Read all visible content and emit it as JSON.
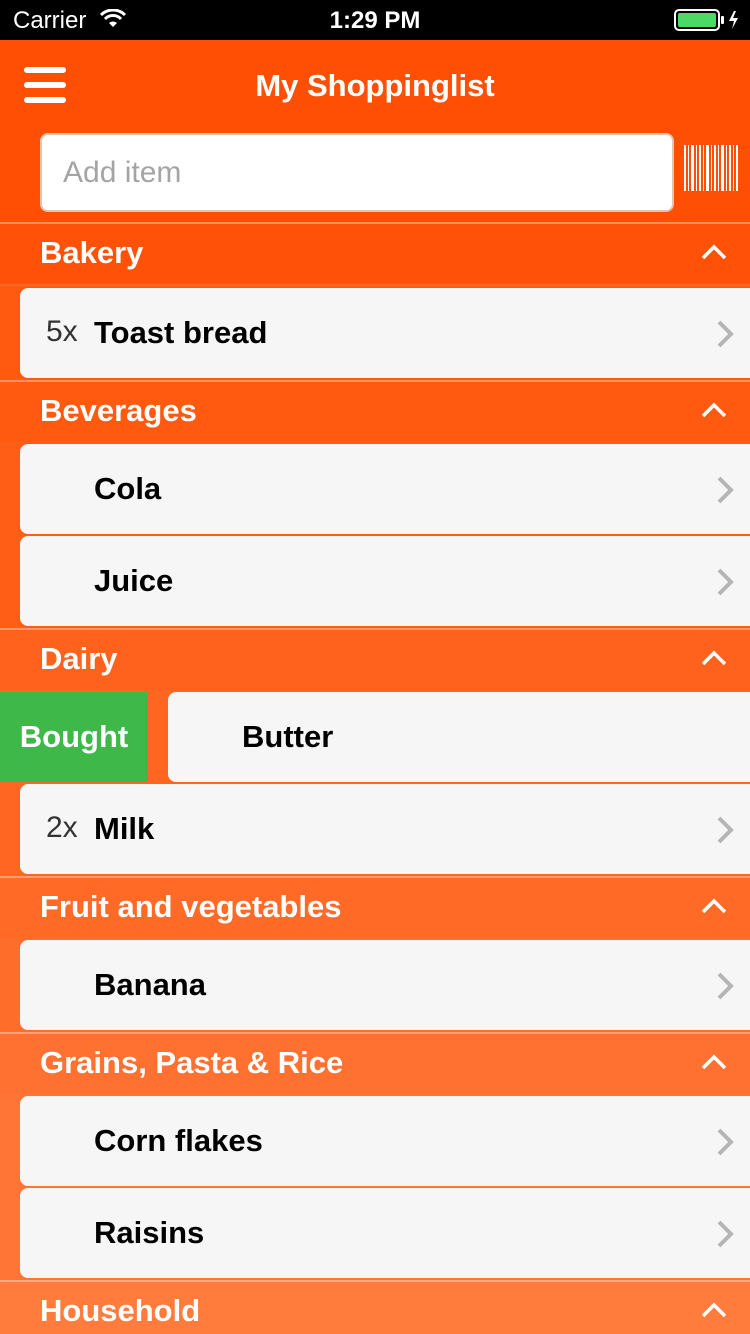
{
  "status_bar": {
    "carrier": "Carrier",
    "time": "1:29 PM"
  },
  "header": {
    "title": "My Shoppinglist",
    "search_placeholder": "Add item"
  },
  "colors": {
    "header": "#ff4f05",
    "item_bg": "#f6f6f6",
    "bought": "#3fb84a"
  },
  "categories": [
    {
      "name": "Bakery",
      "items": [
        {
          "qty": "5x",
          "name": "Toast bread"
        }
      ]
    },
    {
      "name": "Beverages",
      "items": [
        {
          "qty": "",
          "name": "Cola"
        },
        {
          "qty": "",
          "name": "Juice"
        }
      ]
    },
    {
      "name": "Dairy",
      "items": [
        {
          "qty": "",
          "name": "Butter",
          "swipe_action": "Bought"
        },
        {
          "qty": "2x",
          "name": "Milk"
        }
      ]
    },
    {
      "name": "Fruit and vegetables",
      "items": [
        {
          "qty": "",
          "name": "Banana"
        }
      ]
    },
    {
      "name": "Grains, Pasta & Rice",
      "items": [
        {
          "qty": "",
          "name": "Corn flakes"
        },
        {
          "qty": "",
          "name": "Raisins"
        }
      ]
    },
    {
      "name": "Household",
      "items": []
    }
  ]
}
